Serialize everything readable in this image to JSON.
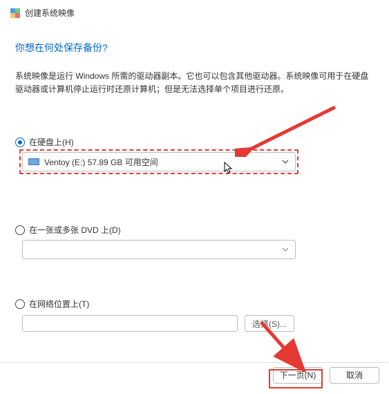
{
  "titlebar": {
    "text": "创建系统映像"
  },
  "heading": "你想在何处保存备份?",
  "description": "系统映像是运行 Windows 所需的驱动器副本。它也可以包含其他驱动器。系统映像可用于在硬盘驱动器或计算机停止运行时还原计算机；但是无法选择单个项目进行还原。",
  "options": {
    "hdd": {
      "label": "在硬盘上(H)",
      "selected": "Ventoy (E:)  57.89 GB 可用空间"
    },
    "dvd": {
      "label": "在一张或多张 DVD 上(D)"
    },
    "network": {
      "label": "在网络位置上(T)",
      "browse": "选择(S)..."
    }
  },
  "footer": {
    "next": "下一页(N)",
    "cancel": "取消"
  }
}
